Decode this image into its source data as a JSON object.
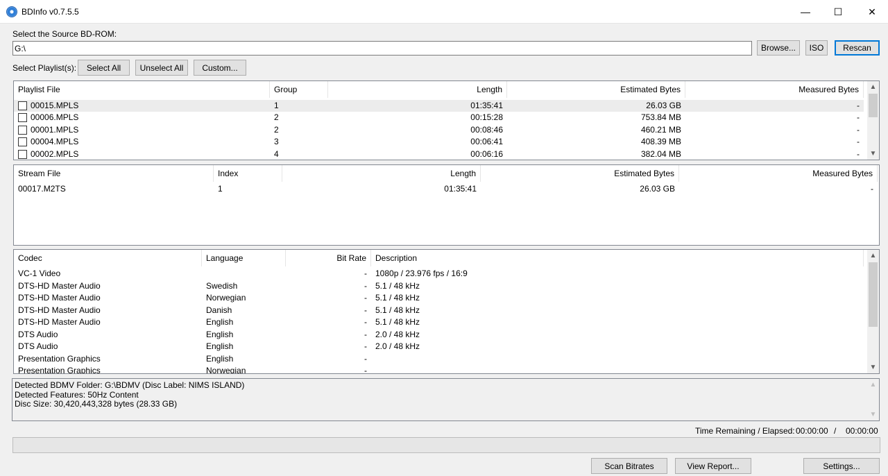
{
  "window": {
    "title": "BDInfo v0.7.5.5",
    "minimize_glyph": "—",
    "maximize_glyph": "☐",
    "close_glyph": "✕"
  },
  "source": {
    "label": "Select the Source BD-ROM:",
    "path": "G:\\",
    "browse": "Browse...",
    "iso": "ISO",
    "rescan": "Rescan"
  },
  "playlist_controls": {
    "label": "Select Playlist(s):",
    "select_all": "Select All",
    "unselect_all": "Unselect All",
    "custom": "Custom..."
  },
  "playlists": {
    "columns": [
      "Playlist File",
      "Group",
      "Length",
      "Estimated Bytes",
      "Measured Bytes"
    ],
    "rows": [
      {
        "file": "00015.MPLS",
        "group": "1",
        "length": "01:35:41",
        "estimated": "26.03 GB",
        "measured": "-"
      },
      {
        "file": "00006.MPLS",
        "group": "2",
        "length": "00:15:28",
        "estimated": "753.84 MB",
        "measured": "-"
      },
      {
        "file": "00001.MPLS",
        "group": "2",
        "length": "00:08:46",
        "estimated": "460.21 MB",
        "measured": "-"
      },
      {
        "file": "00004.MPLS",
        "group": "3",
        "length": "00:06:41",
        "estimated": "408.39 MB",
        "measured": "-"
      },
      {
        "file": "00002.MPLS",
        "group": "4",
        "length": "00:06:16",
        "estimated": "382.04 MB",
        "measured": "-"
      }
    ]
  },
  "streams": {
    "columns": [
      "Stream File",
      "Index",
      "Length",
      "Estimated Bytes",
      "Measured Bytes"
    ],
    "rows": [
      {
        "file": "00017.M2TS",
        "index": "1",
        "length": "01:35:41",
        "estimated": "26.03 GB",
        "measured": "-"
      }
    ]
  },
  "codecs": {
    "columns": [
      "Codec",
      "Language",
      "Bit Rate",
      "Description"
    ],
    "rows": [
      {
        "codec": "VC-1 Video",
        "language": "",
        "bitrate": "-",
        "description": "1080p / 23.976 fps / 16:9"
      },
      {
        "codec": "DTS-HD Master Audio",
        "language": "Swedish",
        "bitrate": "-",
        "description": "5.1 / 48 kHz"
      },
      {
        "codec": "DTS-HD Master Audio",
        "language": "Norwegian",
        "bitrate": "-",
        "description": "5.1 / 48 kHz"
      },
      {
        "codec": "DTS-HD Master Audio",
        "language": "Danish",
        "bitrate": "-",
        "description": "5.1 / 48 kHz"
      },
      {
        "codec": "DTS-HD Master Audio",
        "language": "English",
        "bitrate": "-",
        "description": "5.1 / 48 kHz"
      },
      {
        "codec": "DTS Audio",
        "language": "English",
        "bitrate": "-",
        "description": "2.0 / 48 kHz"
      },
      {
        "codec": "DTS Audio",
        "language": "English",
        "bitrate": "-",
        "description": "2.0 / 48 kHz"
      },
      {
        "codec": "Presentation Graphics",
        "language": "English",
        "bitrate": "-",
        "description": ""
      },
      {
        "codec": "Presentation Graphics",
        "language": "Norwegian",
        "bitrate": "-",
        "description": ""
      }
    ]
  },
  "disc_info": {
    "lines": [
      "Detected BDMV Folder: G:\\BDMV (Disc Label: NIMS ISLAND)",
      "Detected Features: 50Hz Content",
      "Disc Size: 30,420,443,328 bytes (28.33 GB)"
    ]
  },
  "timer": {
    "label": "Time Remaining / Elapsed:",
    "remaining": "00:00:00",
    "separator": "/",
    "elapsed": "00:00:00"
  },
  "progress": {
    "fraction": 0
  },
  "footer": {
    "scan_bitrates": "Scan Bitrates",
    "view_report": "View Report...",
    "settings": "Settings..."
  },
  "icons": {
    "scroll_up": "▲",
    "scroll_down": "▼"
  }
}
